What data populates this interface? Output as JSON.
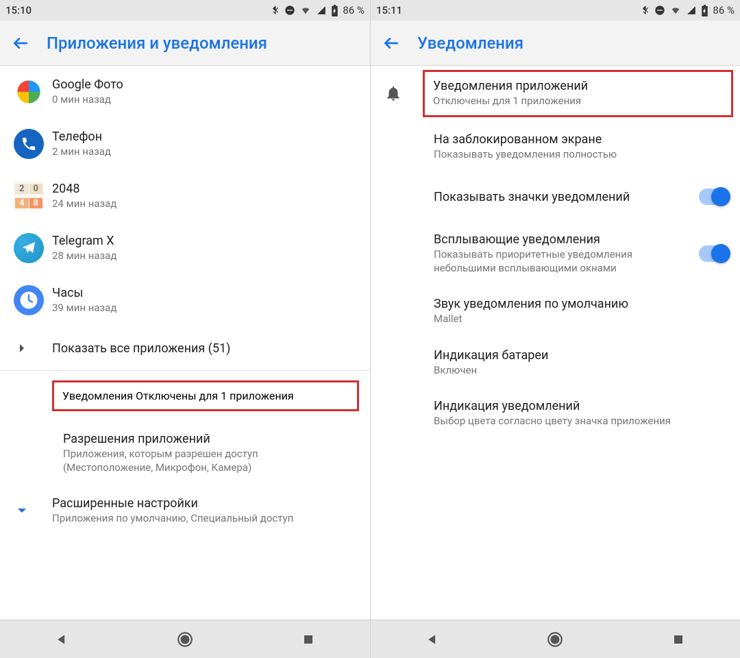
{
  "left": {
    "status": {
      "time": "15:10",
      "battery": "86 %"
    },
    "header": {
      "title": "Приложения и уведомления"
    },
    "apps": [
      {
        "name": "Google Фото",
        "sub": "0 мин назад"
      },
      {
        "name": "Телефон",
        "sub": "2 мин назад"
      },
      {
        "name": "2048",
        "sub": "24 мин назад"
      },
      {
        "name": "Telegram X",
        "sub": "28 мин назад"
      },
      {
        "name": "Часы",
        "sub": "39 мин назад"
      }
    ],
    "show_all": "Показать все приложения (51)",
    "sections": [
      {
        "title": "Уведомления",
        "sub": "Отключены для 1 приложения"
      },
      {
        "title": "Разрешения приложений",
        "sub": "Приложения, которым разрешен доступ (Местоположение, Микрофон, Камера)"
      },
      {
        "title": "Расширенные настройки",
        "sub": "Приложения по умолчанию, Специальный доступ"
      }
    ]
  },
  "right": {
    "status": {
      "time": "15:11",
      "battery": "86 %"
    },
    "header": {
      "title": "Уведомления"
    },
    "items": [
      {
        "title": "Уведомления приложений",
        "sub": "Отключены для 1 приложения"
      },
      {
        "title": "На заблокированном экране",
        "sub": "Показывать уведомления полностью"
      },
      {
        "title": "Показывать значки уведомлений",
        "sub": ""
      },
      {
        "title": "Всплывающие уведомления",
        "sub": "Показывать приоритетные уведомления небольшими всплывающими окнами"
      },
      {
        "title": "Звук уведомления по умолчанию",
        "sub": "Mallet"
      },
      {
        "title": "Индикация батареи",
        "sub": "Включен"
      },
      {
        "title": "Индикация уведомлений",
        "sub": "Выбор цвета согласно цвету значка приложения"
      }
    ]
  }
}
